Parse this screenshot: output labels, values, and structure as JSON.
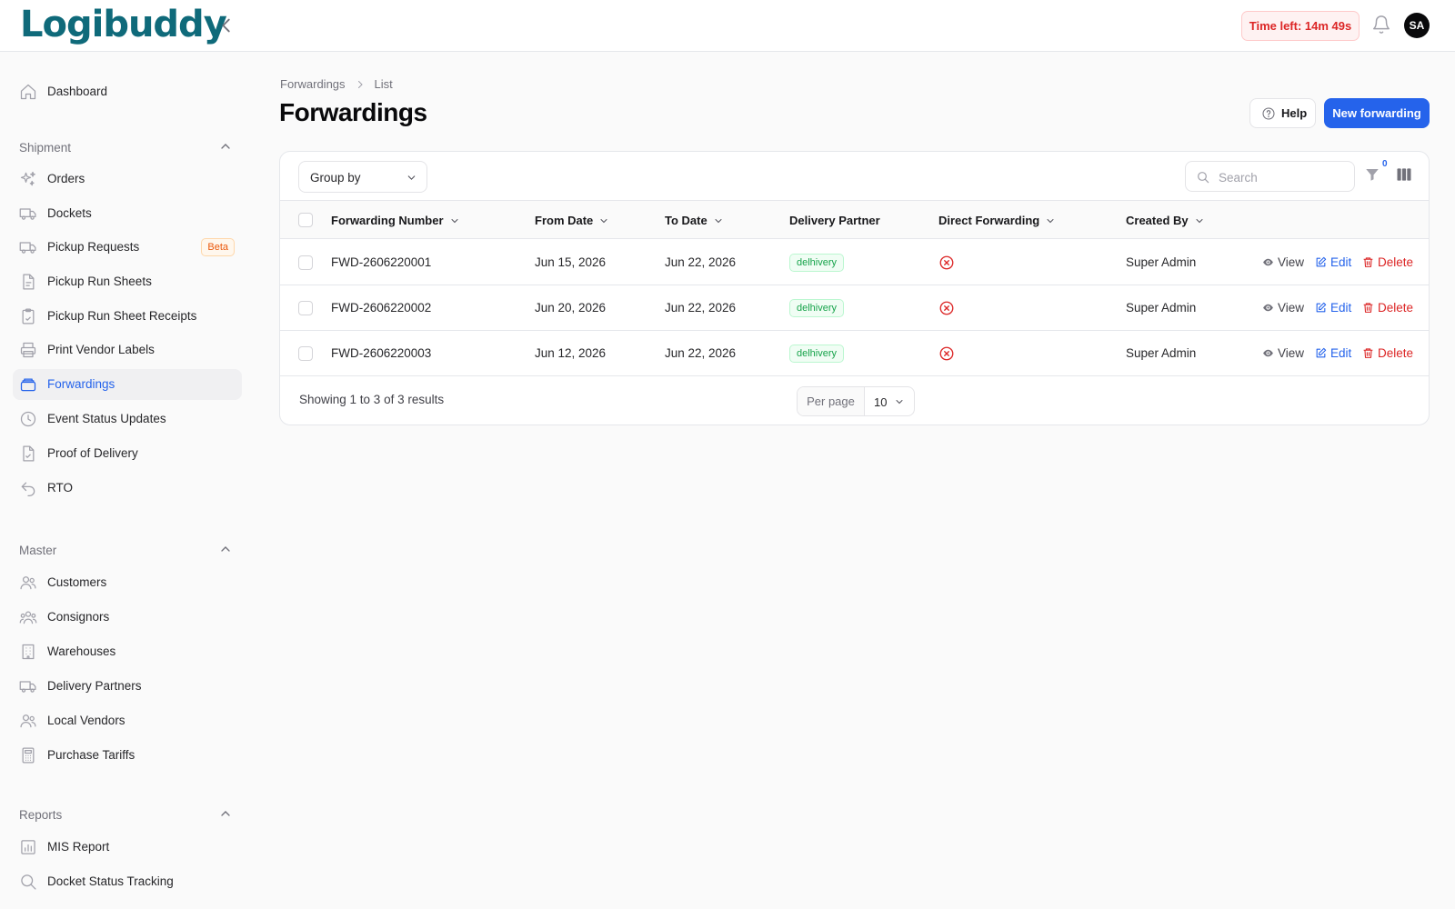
{
  "app": {
    "logo_main": "Logibuddy",
    "timer": "Time left: 14m 49s",
    "avatar": "SA"
  },
  "sidebar": {
    "dashboard": "Dashboard",
    "groups": {
      "shipment": "Shipment",
      "master": "Master",
      "reports": "Reports"
    },
    "items": {
      "orders": "Orders",
      "dockets": "Dockets",
      "pickup_requests": "Pickup Requests",
      "pickup_requests_badge": "Beta",
      "pickup_run_sheets": "Pickup Run Sheets",
      "pickup_run_sheet_receipts": "Pickup Run Sheet Receipts",
      "print_vendor_labels": "Print Vendor Labels",
      "forwardings": "Forwardings",
      "event_status_updates": "Event Status Updates",
      "proof_of_delivery": "Proof of Delivery",
      "rto": "RTO",
      "customers": "Customers",
      "consignors": "Consignors",
      "warehouses": "Warehouses",
      "delivery_partners": "Delivery Partners",
      "local_vendors": "Local Vendors",
      "purchase_tariffs": "Purchase Tariffs",
      "mis_report": "MIS Report",
      "docket_status_tracking": "Docket Status Tracking"
    },
    "active": "forwardings"
  },
  "breadcrumb": {
    "parent": "Forwardings",
    "current": "List"
  },
  "page": {
    "title": "Forwardings",
    "help_label": "Help",
    "new_label": "New forwarding"
  },
  "toolbar": {
    "group_by": "Group by",
    "search_placeholder": "Search",
    "search_value": "",
    "filter_count": "0"
  },
  "table": {
    "columns": {
      "number": "Forwarding Number",
      "from": "From Date",
      "to": "To Date",
      "partner": "Delivery Partner",
      "direct": "Direct Forwarding",
      "created_by": "Created By"
    },
    "rows": [
      {
        "number": "FWD-2606220001",
        "from": "Jun 15, 2026",
        "to": "Jun 22, 2026",
        "partner": "delhivery",
        "direct": false,
        "created_by": "Super Admin"
      },
      {
        "number": "FWD-2606220002",
        "from": "Jun 20, 2026",
        "to": "Jun 22, 2026",
        "partner": "delhivery",
        "direct": false,
        "created_by": "Super Admin"
      },
      {
        "number": "FWD-2606220003",
        "from": "Jun 12, 2026",
        "to": "Jun 22, 2026",
        "partner": "delhivery",
        "direct": false,
        "created_by": "Super Admin"
      }
    ],
    "actions": {
      "view": "View",
      "edit": "Edit",
      "delete": "Delete"
    }
  },
  "footer": {
    "showing": "Showing 1 to 3 of 3 results",
    "per_page_label": "Per page",
    "per_page_value": "10"
  },
  "colors": {
    "primary": "#2563eb",
    "danger": "#dc2626",
    "success": "#16a34a",
    "logo": "#0f6a7a"
  }
}
